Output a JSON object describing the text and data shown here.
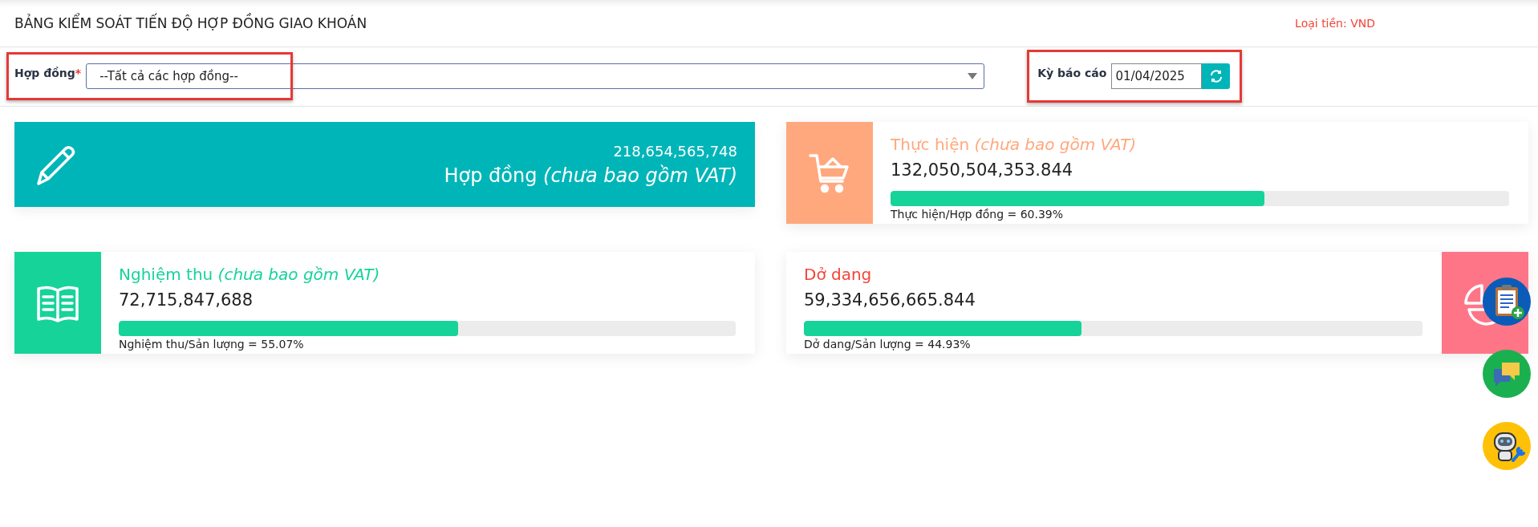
{
  "title": "BẢNG KIỂM SOÁT TIẾN ĐỘ HỢP ĐỒNG GIAO KHOÁN",
  "currency": "Loại tiền: VND",
  "filters": {
    "contract": {
      "label": "Hợp đồng",
      "required_mark": "*",
      "value": "--Tất cả các hợp đồng--"
    },
    "period": {
      "label": "Kỳ báo cáo",
      "value": "01/04/2025"
    }
  },
  "cards": [
    {
      "kind": "contract",
      "color": "#00b5b8",
      "value": "218,654,565,748",
      "title": "Hợp đồng *(chưa bao gồm VAT)*"
    },
    {
      "kind": "execution",
      "color": "#ffa87d",
      "title": "Thực hiện *(chưa bao gồm VAT)*",
      "value": "132,050,504,353.844",
      "level": 0.6039,
      "ratio": "Thực hiện/Hợp đồng = 60.39%"
    },
    {
      "kind": "acceptance",
      "color": "#16d39a",
      "title": "Nghiệm thu *(chưa bao gồm VAT)*",
      "value": "72,715,847,688",
      "level": 0.5507,
      "ratio": "Nghiệm thu/Sản lượng = 55.07%"
    },
    {
      "kind": "wip",
      "color": "#ff7588",
      "title": "Dở dang",
      "value": "59,334,656,665.844",
      "level": 0.4493,
      "ratio": "Dở dang/Sản lượng = 44.93%"
    }
  ],
  "floating_buttons": [
    {
      "kind": "clipboard"
    },
    {
      "kind": "chat"
    },
    {
      "kind": "robot"
    }
  ]
}
